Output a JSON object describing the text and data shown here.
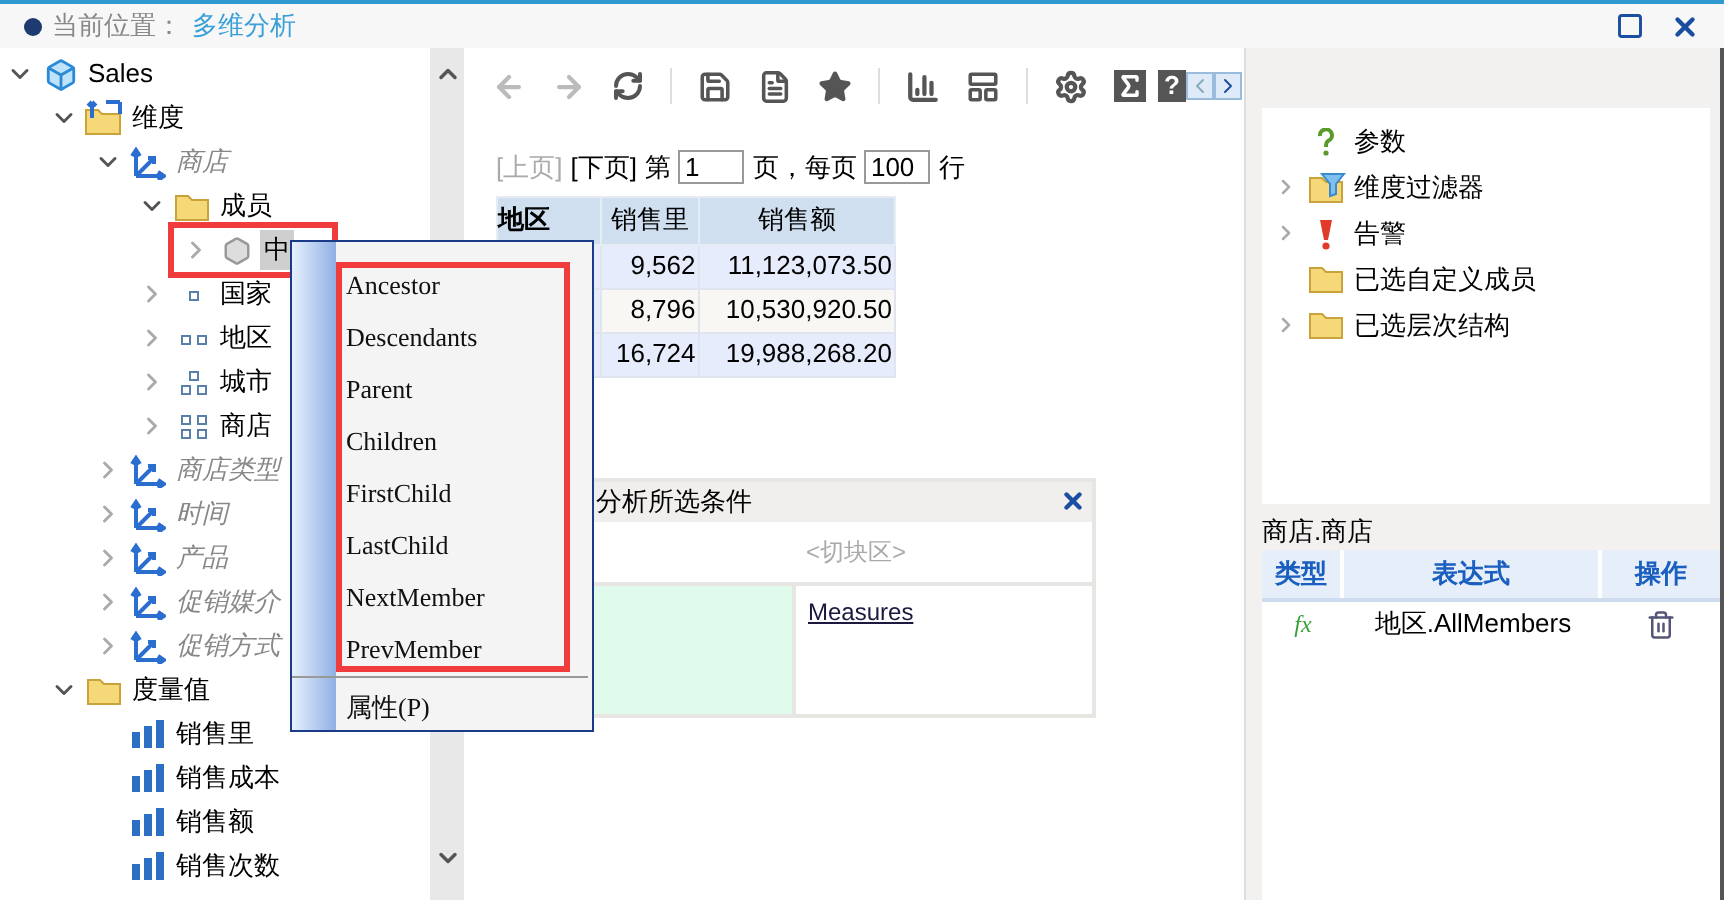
{
  "header": {
    "label": "当前位置：",
    "location": "多维分析"
  },
  "tree": [
    {
      "label": "Sales",
      "kind": "cube",
      "expanded": true,
      "selected": false,
      "children": [
        {
          "label": "维度",
          "kind": "dim-folder",
          "expanded": true,
          "selected": false,
          "children": [
            {
              "label": "商店",
              "kind": "hierarchy",
              "expanded": true,
              "selected": false,
              "children": [
                {
                  "label": "成员",
                  "kind": "folder",
                  "expanded": true,
                  "selected": false,
                  "children": [
                    {
                      "label": "中",
                      "kind": "member",
                      "expanded": false,
                      "selected": true
                    }
                  ]
                },
                {
                  "label": "国家",
                  "kind": "level-1",
                  "expanded": false,
                  "selected": false
                },
                {
                  "label": "地区",
                  "kind": "level-2",
                  "expanded": false,
                  "selected": false
                },
                {
                  "label": "城市",
                  "kind": "level-3",
                  "expanded": false,
                  "selected": false
                },
                {
                  "label": "商店",
                  "kind": "level-4",
                  "expanded": false,
                  "selected": false
                }
              ]
            },
            {
              "label": "商店类型",
              "kind": "hierarchy",
              "expanded": false,
              "selected": false
            },
            {
              "label": "时间",
              "kind": "hierarchy",
              "expanded": false,
              "selected": false
            },
            {
              "label": "产品",
              "kind": "hierarchy",
              "expanded": false,
              "selected": false
            },
            {
              "label": "促销媒介",
              "kind": "hierarchy",
              "expanded": false,
              "selected": false
            },
            {
              "label": "促销方式",
              "kind": "hierarchy",
              "expanded": false,
              "selected": false
            }
          ]
        },
        {
          "label": "度量值",
          "kind": "folder",
          "expanded": true,
          "selected": false,
          "children": [
            {
              "label": "销售里",
              "kind": "measure",
              "selected": false
            },
            {
              "label": "销售成本",
              "kind": "measure",
              "selected": false
            },
            {
              "label": "销售额",
              "kind": "measure",
              "selected": false
            },
            {
              "label": "销售次数",
              "kind": "measure",
              "selected": false
            }
          ]
        }
      ]
    }
  ],
  "context_menu": {
    "items": [
      "Ancestor",
      "Descendants",
      "Parent",
      "Children",
      "FirstChild",
      "LastChild",
      "NextMember",
      "PrevMember"
    ],
    "footer_item": "属性(P)"
  },
  "toolbar": {
    "help": "?"
  },
  "pager": {
    "prev": "[上页]",
    "prev_disabled": true,
    "next": "[下页]",
    "next_disabled": false,
    "page_prefix": "第",
    "page": "1",
    "per_page_label": "页，每页",
    "per_page": "100",
    "rows_suffix": "行"
  },
  "table": {
    "columns": [
      "地区",
      "销售里",
      "销售额"
    ],
    "rows": [
      [
        "",
        "9,562",
        "11,123,073.50"
      ],
      [
        "",
        "8,796",
        "10,530,920.50"
      ],
      [
        "",
        "16,724",
        "19,988,268.20"
      ]
    ]
  },
  "filter_panel": {
    "title": "分析所选条件",
    "slice_area": "<切块区>",
    "measures_link": "Measures"
  },
  "right_tree": [
    {
      "label": "参数",
      "kind": "parameter"
    },
    {
      "label": "维度过滤器",
      "kind": "filter",
      "expanded": false
    },
    {
      "label": "告警",
      "kind": "alert",
      "expanded": false
    },
    {
      "label": "已选自定义成员",
      "kind": "folder"
    },
    {
      "label": "已选层次结构",
      "kind": "folder",
      "expanded": false
    }
  ],
  "expr_panel": {
    "title": "商店.商店",
    "columns": [
      "类型",
      "表达式",
      "操作"
    ],
    "rows": [
      {
        "type": "fx",
        "expression": "地区.AllMembers"
      }
    ]
  }
}
